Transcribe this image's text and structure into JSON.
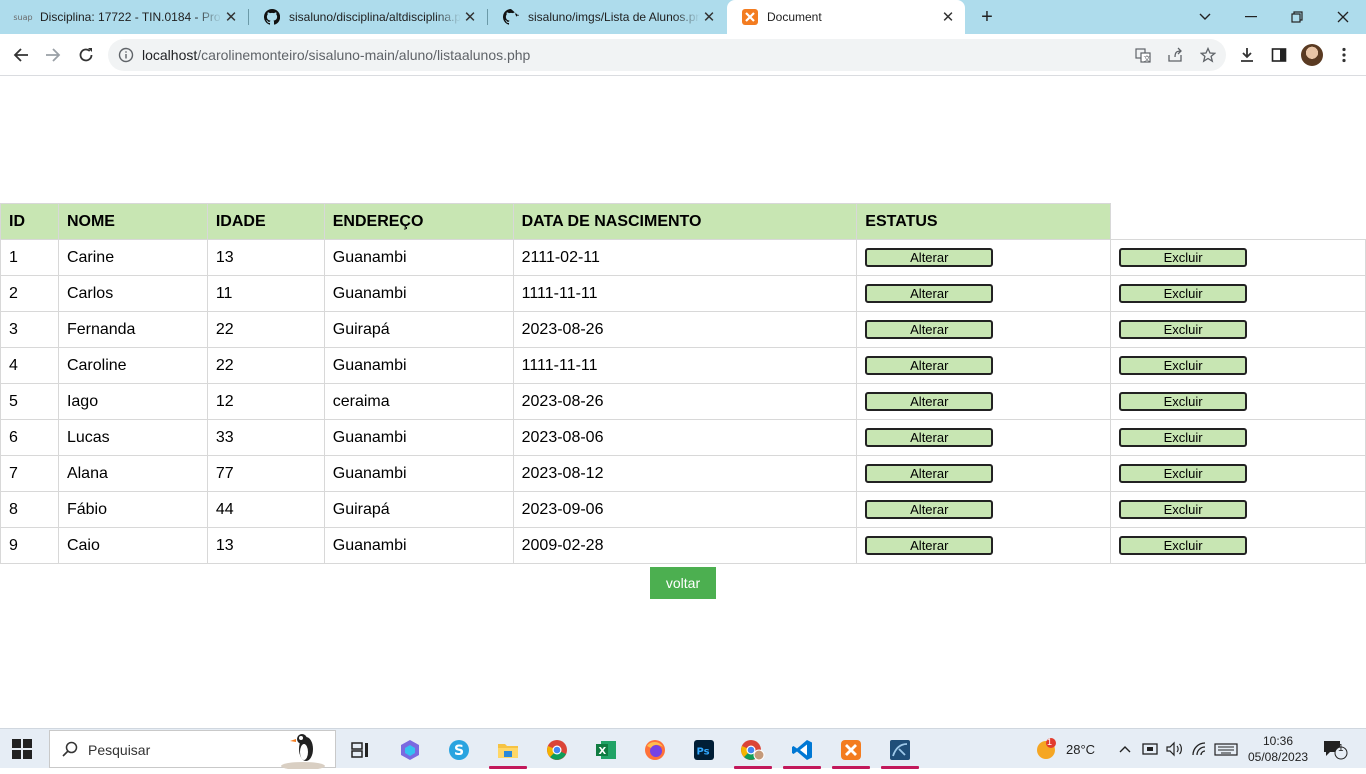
{
  "browser": {
    "tabs": [
      {
        "favicon": "suap-icon",
        "favicon_text": "suap",
        "title": "Disciplina: 17722 - TIN.0184 - Pro"
      },
      {
        "favicon": "github-icon",
        "title": "sisaluno/disciplina/altdisciplina.p"
      },
      {
        "favicon": "github-icon",
        "title": "sisaluno/imgs/Lista de Alunos.pn"
      },
      {
        "favicon": "xampp-icon",
        "title": "Document",
        "active": true
      }
    ],
    "url_host": "localhost",
    "url_path": "/carolinemonteiro/sisaluno-main/aluno/listaalunos.php"
  },
  "table": {
    "headers": [
      "ID",
      "NOME",
      "IDADE",
      "ENDEREÇO",
      "DATA DE NASCIMENTO",
      "ESTATUS"
    ],
    "alter_label": "Alterar",
    "delete_label": "Excluir",
    "rows": [
      {
        "id": "1",
        "nome": "Carine",
        "idade": "13",
        "endereco": "Guanambi",
        "nascimento": "2111-02-11"
      },
      {
        "id": "2",
        "nome": "Carlos",
        "idade": "11",
        "endereco": "Guanambi",
        "nascimento": "1111-11-11"
      },
      {
        "id": "3",
        "nome": "Fernanda",
        "idade": "22",
        "endereco": "Guirapá",
        "nascimento": "2023-08-26"
      },
      {
        "id": "4",
        "nome": "Caroline",
        "idade": "22",
        "endereco": "Guanambi",
        "nascimento": "1111-11-11"
      },
      {
        "id": "5",
        "nome": "Iago",
        "idade": "12",
        "endereco": "ceraima",
        "nascimento": "2023-08-26"
      },
      {
        "id": "6",
        "nome": "Lucas",
        "idade": "33",
        "endereco": "Guanambi",
        "nascimento": "2023-08-06"
      },
      {
        "id": "7",
        "nome": "Alana",
        "idade": "77",
        "endereco": "Guanambi",
        "nascimento": "2023-08-12"
      },
      {
        "id": "8",
        "nome": "Fábio",
        "idade": "44",
        "endereco": "Guirapá",
        "nascimento": "2023-09-06"
      },
      {
        "id": "9",
        "nome": "Caio",
        "idade": "13",
        "endereco": "Guanambi",
        "nascimento": "2009-02-28"
      }
    ]
  },
  "back_button": "voltar",
  "colors": {
    "header_bg": "#c8e6b3",
    "button_bg": "#c8e6b3",
    "back_button_bg": "#4caf50",
    "tabstrip_bg": "#aedcec"
  },
  "taskbar": {
    "search_placeholder": "Pesquisar",
    "apps": [
      "task-view-icon",
      "copilot-icon",
      "s-app-icon",
      "file-explorer-icon",
      "chrome-icon",
      "excel-icon",
      "firefox-icon",
      "photoshop-icon",
      "chrome-profile-icon",
      "vscode-icon",
      "xampp-icon",
      "mysql-workbench-icon"
    ],
    "weather_temp": "28°C",
    "weather_badge": "1",
    "time": "10:36",
    "date": "05/08/2023",
    "notification_count": "1"
  }
}
